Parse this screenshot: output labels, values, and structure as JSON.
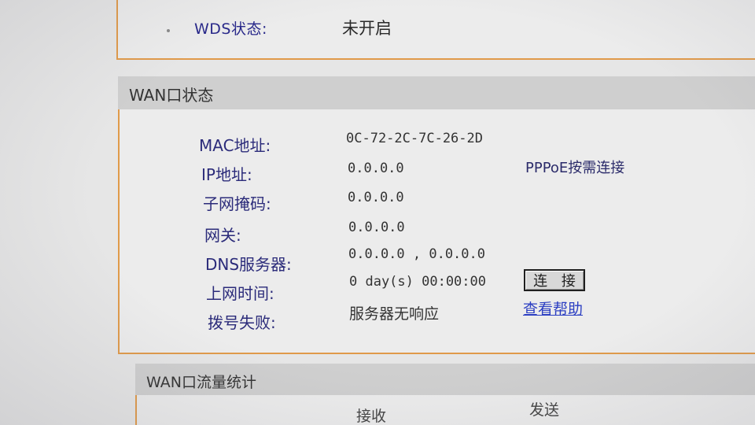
{
  "wds": {
    "label": "WDS状态:",
    "value": "未开启"
  },
  "wan_status": {
    "title": "WAN口状态",
    "fields": [
      {
        "label": "MAC地址:",
        "value": "0C-72-2C-7C-26-2D"
      },
      {
        "label": "IP地址:",
        "value": "0.0.0.0"
      },
      {
        "label": "子网掩码:",
        "value": "0.0.0.0"
      },
      {
        "label": "网关:",
        "value": "0.0.0.0"
      },
      {
        "label": "DNS服务器:",
        "value": "0.0.0.0 , 0.0.0.0"
      },
      {
        "label": "上网时间:",
        "value": "0 day(s) 00:00:00"
      },
      {
        "label": "拨号失败:",
        "value": "服务器无响应"
      }
    ],
    "connection_mode": "PPPoE按需连接",
    "connect_button": "连 接",
    "help_link": "查看帮助"
  },
  "wan_traffic": {
    "title": "WAN口流量统计",
    "columns": [
      "接收",
      "发送"
    ]
  }
}
